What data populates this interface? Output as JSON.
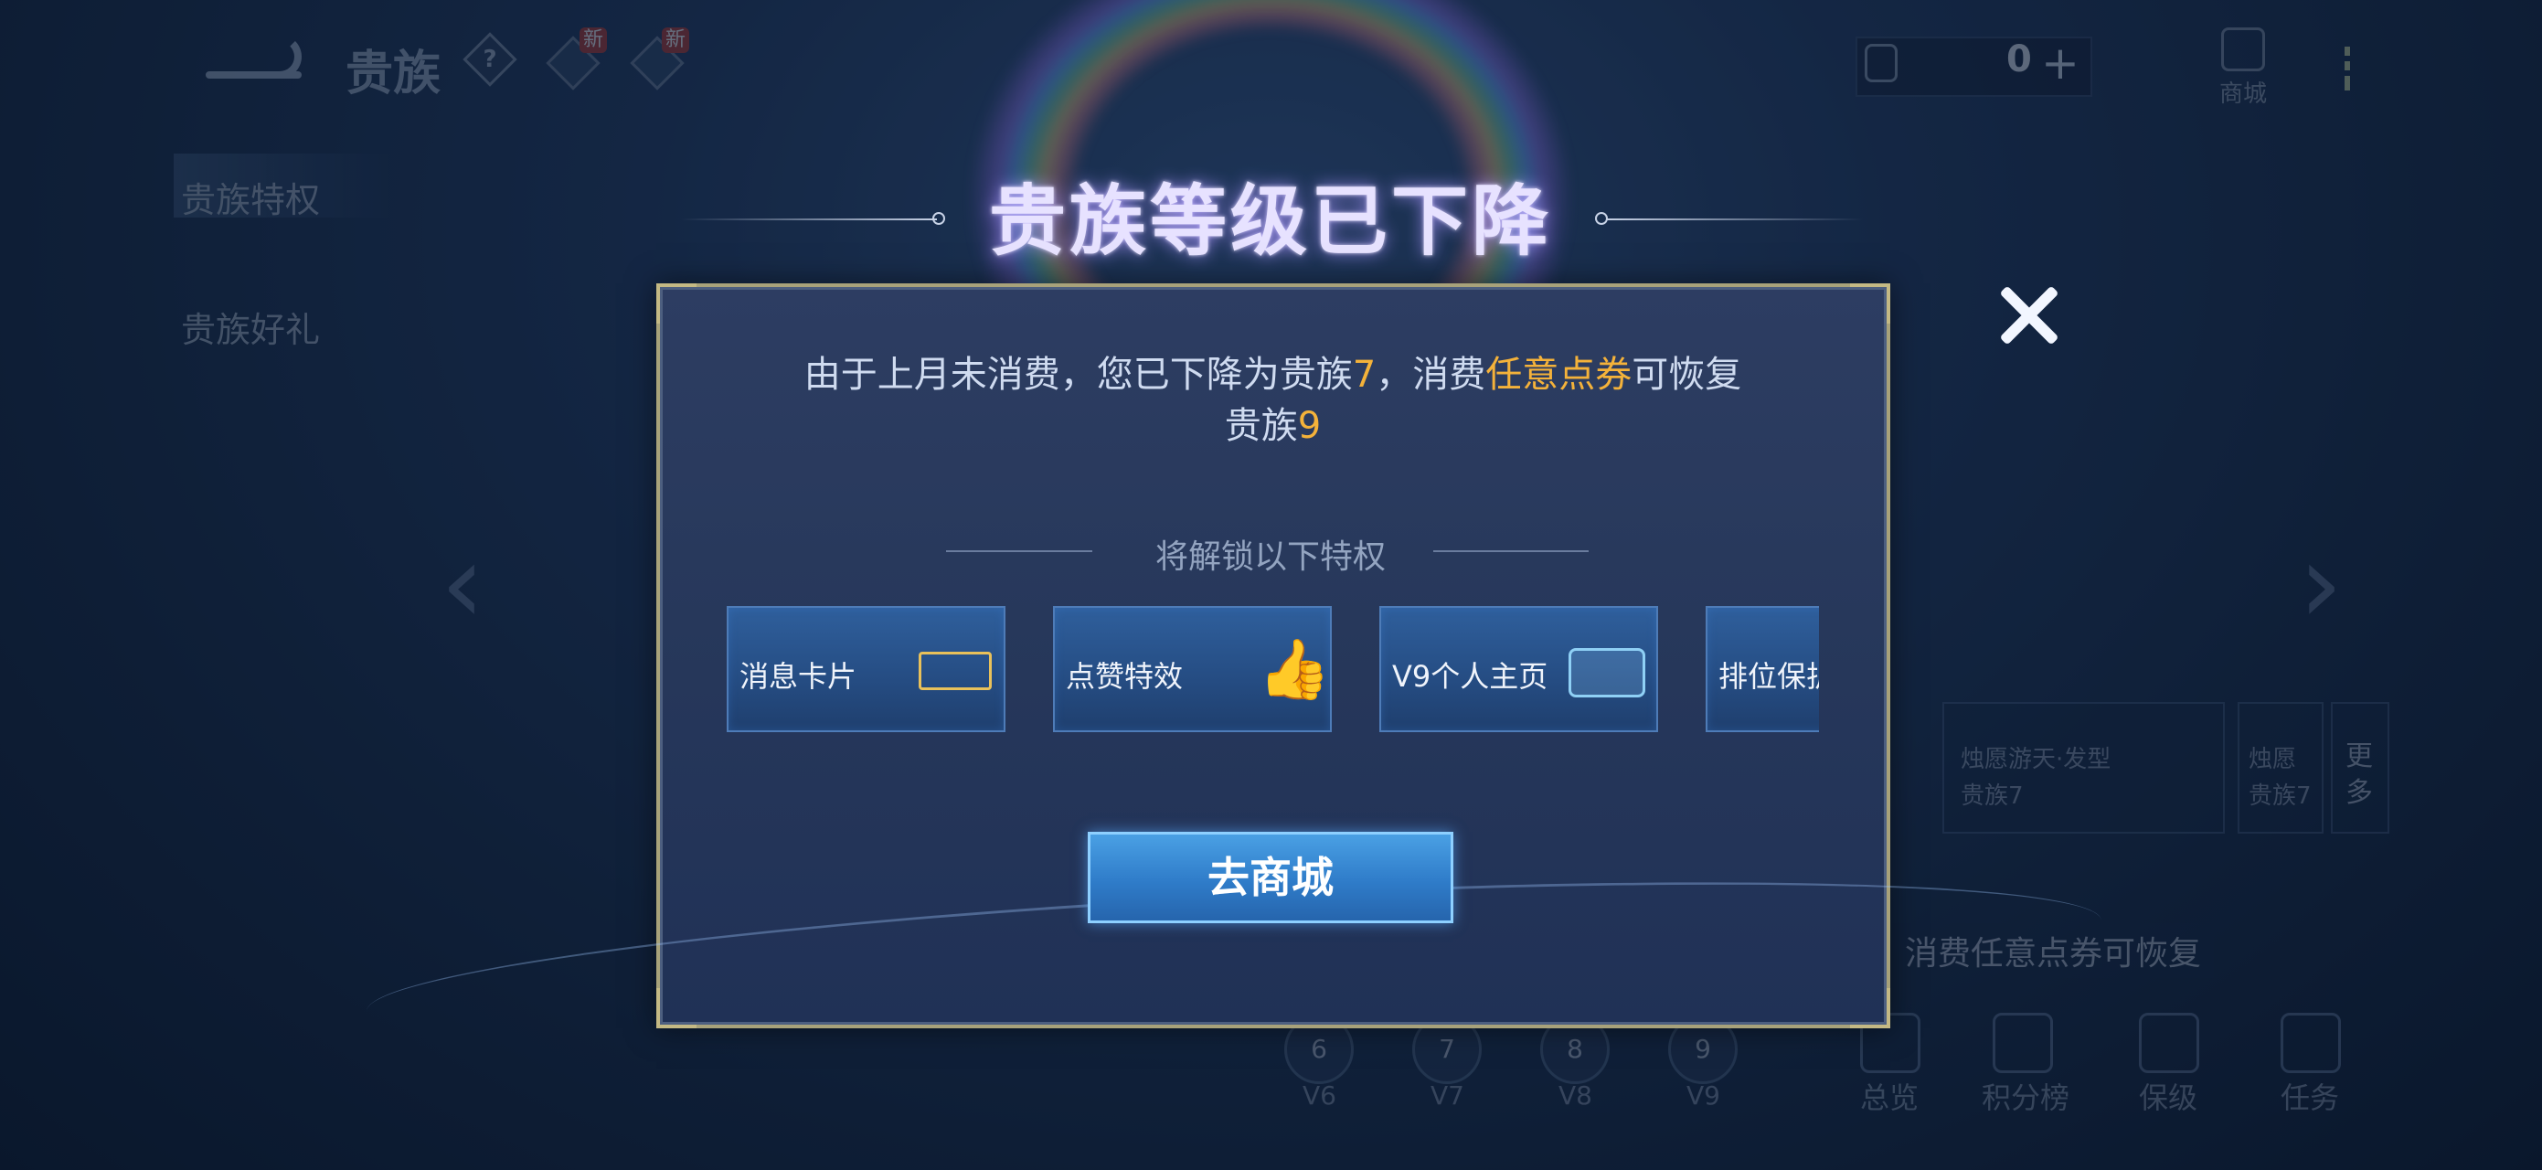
{
  "header": {
    "back_icon": "back-arrow-icon",
    "title": "贵族",
    "help_icon": "question-icon",
    "help_symbol": "?",
    "new_badges": [
      "新",
      "新"
    ],
    "currency_amount": "0",
    "plus_symbol": "+",
    "shop_label": "商城"
  },
  "sidebar": {
    "items": [
      {
        "label": "贵族特权",
        "selected": true
      },
      {
        "label": "贵族好礼",
        "selected": false
      }
    ]
  },
  "background": {
    "gift_cards": [
      {
        "title": "烛愿游天·发型",
        "subtitle": "贵族7"
      },
      {
        "title": "烛愿",
        "subtitle": "贵族7"
      }
    ],
    "more_label": "更多",
    "restore_hint": "消费任意点券可恢复",
    "levels": [
      {
        "number": "6",
        "label": "V6"
      },
      {
        "number": "7",
        "label": "V7"
      },
      {
        "number": "8",
        "label": "V8"
      },
      {
        "number": "9",
        "label": "V9"
      }
    ],
    "bottom_tabs": [
      {
        "label": "总览",
        "icon": "overview-icon"
      },
      {
        "label": "积分榜",
        "icon": "leaderboard-icon"
      },
      {
        "label": "保级",
        "icon": "shield-icon"
      },
      {
        "label": "任务",
        "icon": "task-icon"
      }
    ]
  },
  "modal": {
    "title": "贵族等级已下降",
    "desc_part1": "由于上月未消费，您已下降为贵族",
    "desc_level": "7",
    "desc_part2": "，消费",
    "desc_highlight": "任意点券",
    "desc_part3": "可恢复",
    "desc_part4": "贵族",
    "desc_target": "9",
    "unlock_title": "将解锁以下特权",
    "privileges": [
      {
        "label": "消息卡片",
        "icon": "message-card-icon"
      },
      {
        "label": "点赞特效",
        "icon": "thumbs-up-icon"
      },
      {
        "label": "V9个人主页",
        "icon": "profile-page-icon"
      },
      {
        "label": "排位保护",
        "icon": "rank-protect-icon"
      }
    ],
    "shop_button": "去商城",
    "highlight_color": "#f4b23a"
  }
}
